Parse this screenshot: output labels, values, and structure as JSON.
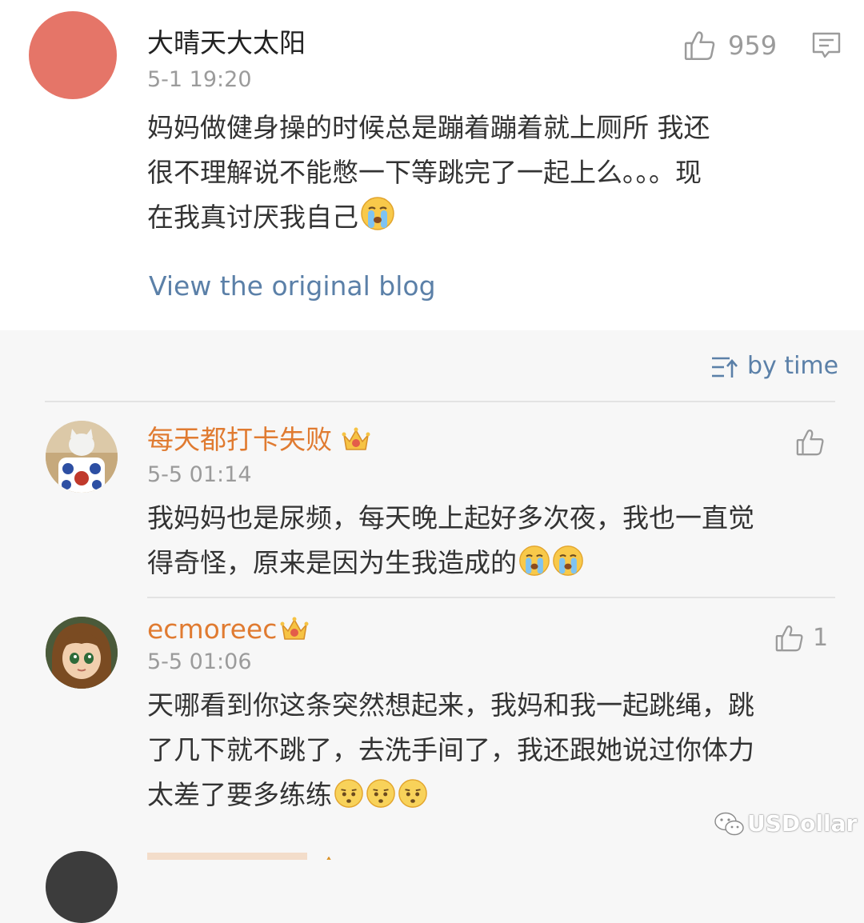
{
  "main_comment": {
    "username": "大晴天大太阳",
    "time": "5-1 19:20",
    "like_count": "959",
    "text_lines": [
      "妈妈做健身操的时候总是蹦着蹦着就上厕所 我还",
      "很不理解说不能憋一下等跳完了一起上么。。。现",
      "在我真讨厌我自己"
    ],
    "text_emojis": [
      "crying-emoji"
    ],
    "view_original_label": "View the original blog",
    "avatar_color": "#e57568"
  },
  "sort": {
    "label": "by time"
  },
  "replies": [
    {
      "username": "每天都打卡失败",
      "time": "5-5 01:14",
      "like_count": "",
      "text_lines": [
        "我妈妈也是尿频，每天晚上起好多次夜，我也一直觉",
        "得奇怪，原来是因为生我造成的"
      ],
      "text_emojis": [
        "crying-emoji",
        "crying-emoji"
      ]
    },
    {
      "username": "ecmoreec",
      "time": "5-5 01:06",
      "like_count": "1",
      "text_lines": [
        "天哪看到你这条突然想起来，我妈和我一起跳绳，跳",
        "了几下就不跳了，去洗手间了，我还跟她说过你体力",
        "太差了要多练练"
      ],
      "text_emojis": [
        "speechless-emoji",
        "speechless-emoji",
        "speechless-emoji"
      ]
    },
    {
      "username": "",
      "time": "",
      "like_count": "",
      "text_lines": [],
      "text_emojis": []
    }
  ],
  "watermark": {
    "text": "USDollar"
  },
  "colors": {
    "vip_username": "#e07b31",
    "link": "#5b80a8",
    "muted": "#9b9b9b",
    "text": "#333333",
    "background": "#f7f7f7",
    "card": "#ffffff"
  }
}
